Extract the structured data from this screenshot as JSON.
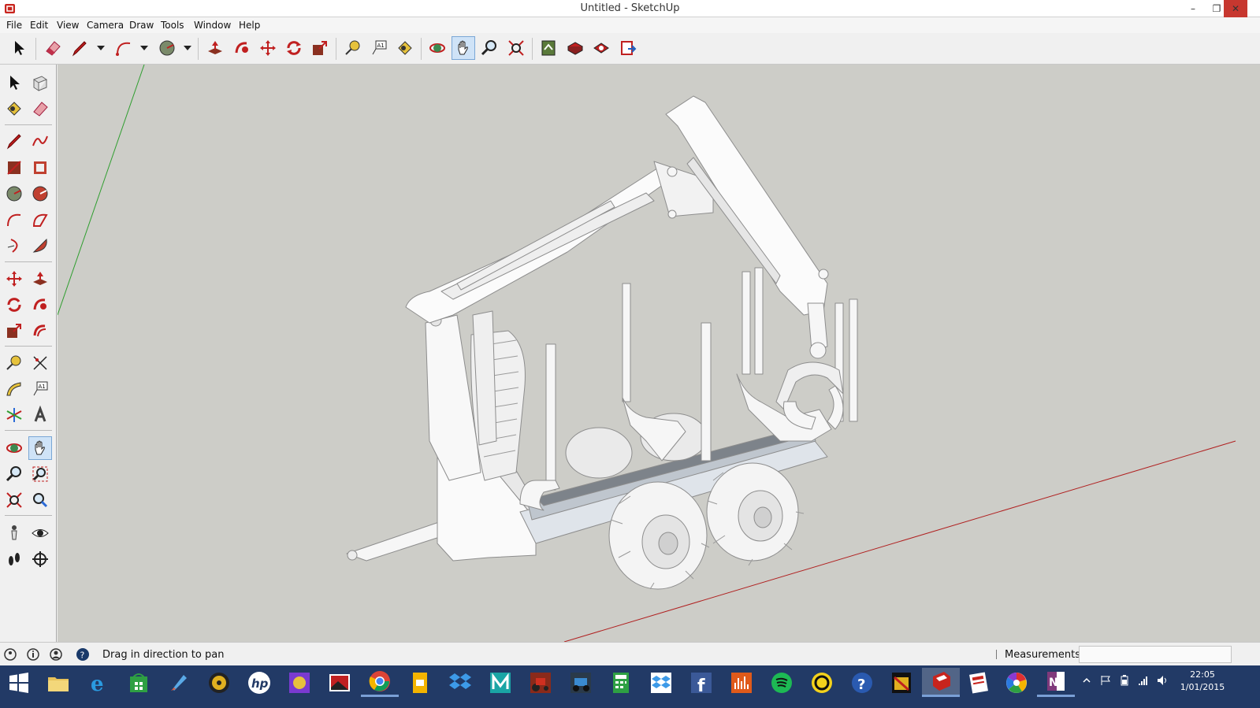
{
  "window": {
    "title": "Untitled - SketchUp",
    "minimize_glyph": "–",
    "maximize_glyph": "❐",
    "close_glyph": "✕"
  },
  "menu": [
    "File",
    "Edit",
    "View",
    "Camera",
    "Draw",
    "Tools",
    "Window",
    "Help"
  ],
  "toolbar": {
    "tools": [
      "select-icon",
      "eraser-icon",
      "line-icon",
      "arc-icon",
      "circle-icon",
      "push-pull-icon",
      "follow-me-icon",
      "move-icon",
      "rotate-icon",
      "scale-icon",
      "tape-measure-icon",
      "text-icon",
      "paint-bucket-icon",
      "orbit-icon",
      "pan-icon",
      "zoom-icon",
      "zoom-extents-icon",
      "warehouse-icon",
      "get-models-icon",
      "share-model-icon",
      "extension-warehouse-icon"
    ],
    "active_tool": "pan-icon"
  },
  "left_toolbar": {
    "tools": [
      "select-icon",
      "make-component-icon",
      "paint-bucket-icon",
      "eraser-icon",
      "line-icon",
      "freehand-icon",
      "rectangle-icon",
      "rotated-rectangle-icon",
      "circle-icon",
      "polygon-icon",
      "arc-icon",
      "two-point-arc-icon",
      "three-point-arc-icon",
      "pie-icon",
      "move-icon",
      "push-pull-icon",
      "rotate-icon",
      "follow-me-icon",
      "scale-icon",
      "offset-icon",
      "tape-measure-icon",
      "dimension-icon",
      "protractor-icon",
      "text-label-icon",
      "axes-icon",
      "3d-text-icon",
      "orbit-icon",
      "pan-icon",
      "zoom-icon",
      "zoom-window-icon",
      "zoom-extents-icon",
      "previous-view-icon",
      "position-camera-icon",
      "look-around-icon",
      "walk-icon",
      "section-plane-icon"
    ],
    "active_tool": "pan-icon"
  },
  "viewport": {
    "background": "#cdcdc8",
    "green_axis_color": "#2f9e2f",
    "red_axis_color": "#b02020",
    "model": "forestry trailer with crane"
  },
  "status": {
    "message": "Drag in direction to pan",
    "measurements_label": "Measurements",
    "measurements_value": ""
  },
  "taskbar": {
    "apps": [
      "start-icon",
      "file-explorer-icon",
      "internet-explorer-icon",
      "store-icon",
      "rocket-app-icon",
      "media-player-icon",
      "hp-icon",
      "game-app-icon",
      "photo-app-icon",
      "chrome-icon",
      "slides-app-icon",
      "dropbox-icon",
      "3ds-max-icon",
      "tractor-game-icon",
      "farming-sim-icon",
      "calculator-icon",
      "dropbox-alt-icon",
      "facebook-icon",
      "audio-app-icon",
      "spotify-icon",
      "circle-app-icon",
      "help-icon",
      "studio-app-icon",
      "sketchup-icon",
      "layout-icon",
      "picasa-icon",
      "onenote-icon"
    ],
    "active_app": "sketchup-icon",
    "clock_time": "22:05",
    "clock_date": "1/01/2015"
  }
}
